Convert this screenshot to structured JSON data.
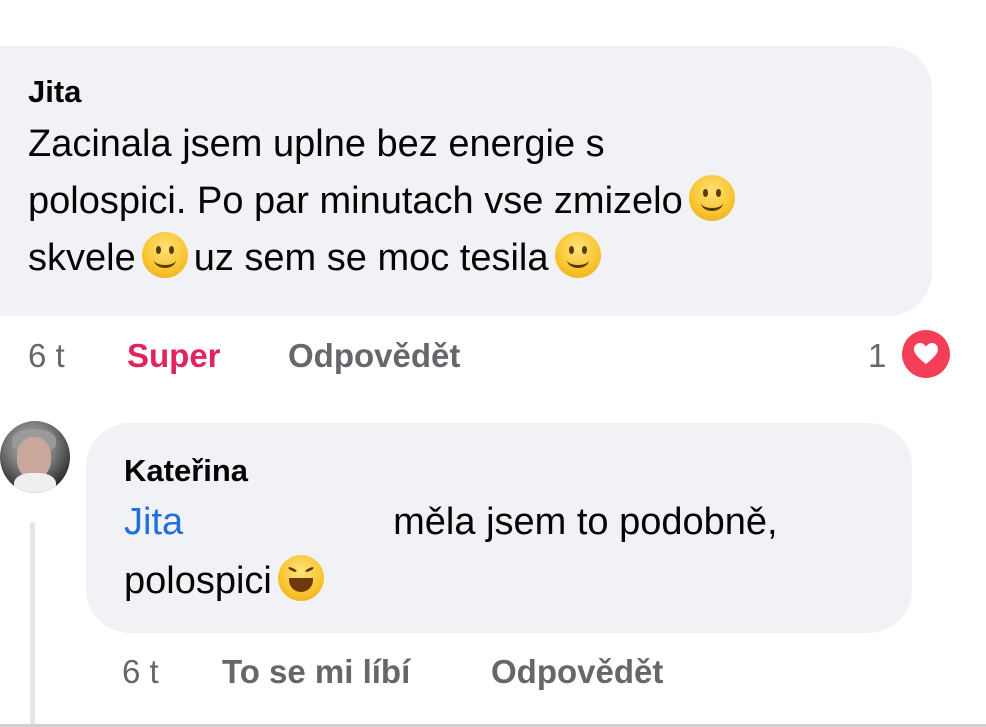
{
  "comment1": {
    "author": "Jita",
    "line1": "Zacinala jsem uplne bez energie s",
    "line2": "polospici. Po par minutach vse zmizelo",
    "line3a": "skvele",
    "line3b": "uz sem se moc tesila",
    "time": "6 t",
    "reaction_label": "Super",
    "reply_label": "Odpovědět",
    "reaction_count": "1",
    "reaction_icon": "heart-reaction-icon",
    "colors": {
      "super": "#e0245e",
      "heart": "#f33e58"
    }
  },
  "comment2": {
    "author": "Kateřina",
    "mention": "Jita",
    "line1": "měla jsem to podobně,",
    "line2": "polospici",
    "time": "6 t",
    "like_label": "To se mi líbí",
    "reply_label": "Odpovědět",
    "colors": {
      "mention": "#216fdb"
    }
  }
}
